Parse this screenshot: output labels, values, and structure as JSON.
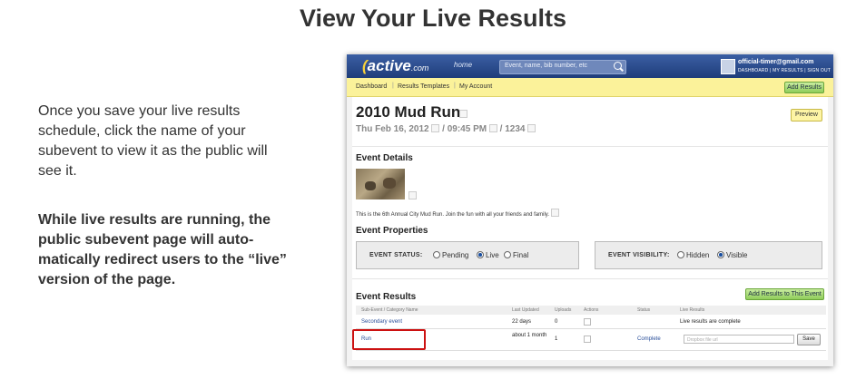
{
  "slide": {
    "title": "View Your Live Results",
    "paragraph1": "Once you save your live results schedule, click the name of your subevent to view it as the public will see it.",
    "paragraph2": "While live results are running, the public subevent page will auto-matically redirect users to the “live” version of the page."
  },
  "app": {
    "logo_text": "active",
    "logo_suffix": ".com",
    "home_link": "home",
    "search_placeholder": "Event, name, bib number, etc",
    "account_email": "official-timer@gmail.com",
    "account_links": "DASHBOARD | MY RESULTS | SIGN OUT",
    "nav": {
      "dashboard": "Dashboard",
      "templates": "Results Templates",
      "account": "My Account",
      "add_results": "Add Results"
    },
    "event": {
      "title": "2010 Mud Run",
      "date": "Thu Feb 16, 2012",
      "time": "09:45 PM",
      "number": "1234",
      "preview": "Preview",
      "details_heading": "Event Details",
      "description": "This is the 6th Annual City Mud Run. Join the fun with all your friends and family.",
      "properties_heading": "Event Properties",
      "status_label": "EVENT STATUS:",
      "status_options": [
        "Pending",
        "Live",
        "Final"
      ],
      "status_selected": "Live",
      "visibility_label": "EVENT VISIBILITY:",
      "visibility_options": [
        "Hidden",
        "Visible"
      ],
      "visibility_selected": "Visible"
    },
    "results": {
      "heading": "Event Results",
      "add_button": "Add Results to This Event",
      "columns": [
        "Sub-Event / Category Name",
        "Last Updated",
        "Uploads",
        "Actions",
        "Status",
        "Live Results"
      ],
      "rows": [
        {
          "name": "Secondary event",
          "updated": "22 days",
          "uploads": "0",
          "status": "",
          "live": "Live results are complete"
        },
        {
          "name": "Run",
          "updated": "about 1 month",
          "uploads": "1",
          "status": "Complete",
          "live": ""
        }
      ],
      "dropbox_placeholder": "Dropbox file url",
      "save": "Save"
    }
  }
}
